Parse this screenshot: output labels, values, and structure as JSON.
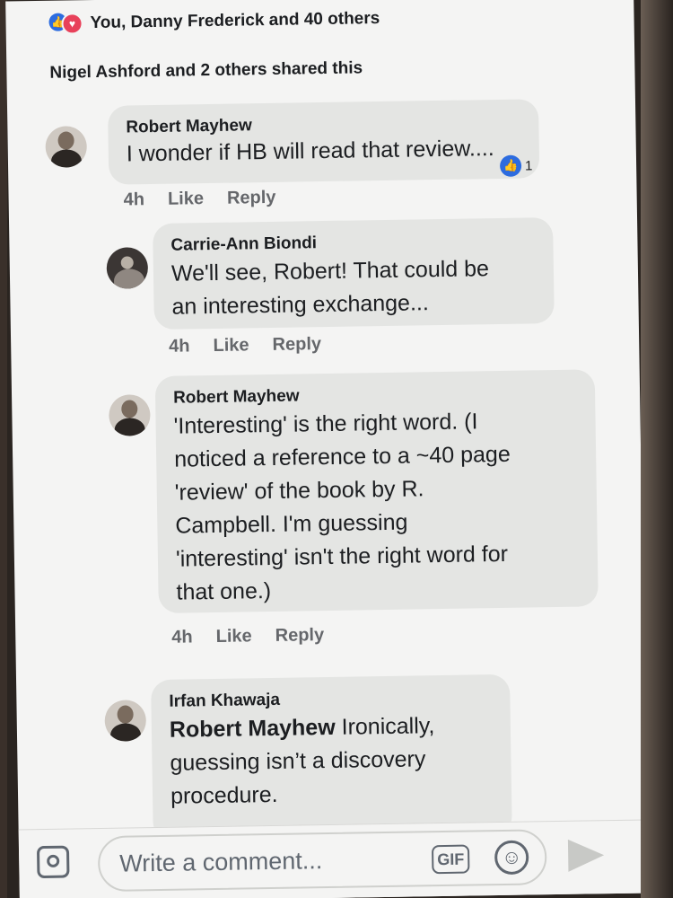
{
  "post": {
    "reactions_text": "You, Danny Frederick and 40 others",
    "shared_text": "Nigel Ashford and 2 others shared this"
  },
  "comments": [
    {
      "author": "Robert Mayhew",
      "text": "I wonder if HB will read that review....",
      "time": "4h",
      "like_label": "Like",
      "reply_label": "Reply",
      "like_count": "1"
    },
    {
      "author": "Carrie-Ann Biondi",
      "text_lines": [
        "We'll see, Robert! That could be",
        "an interesting exchange..."
      ],
      "time": "4h",
      "like_label": "Like",
      "reply_label": "Reply"
    },
    {
      "author": "Robert Mayhew",
      "text_lines": [
        "'Interesting' is the right word. (I",
        "noticed a reference to a ~40 page",
        "'review' of the book by R.",
        "Campbell. I'm guessing",
        "'interesting' isn't the right word for",
        "that one.)"
      ],
      "time": "4h",
      "like_label": "Like",
      "reply_label": "Reply"
    },
    {
      "author": "Irfan Khawaja",
      "mention": "Robert Mayhew",
      "text_lines": [
        "Ironically,",
        "guessing isn’t a discovery",
        "procedure."
      ]
    }
  ],
  "composer": {
    "placeholder": "Write a comment...",
    "gif_label": "GIF"
  },
  "icons": {
    "like": "like-icon",
    "love": "love-icon",
    "camera": "camera-icon",
    "emoji": "emoji-icon",
    "send": "send-icon"
  },
  "colors": {
    "like_blue": "#2d6cdf",
    "love_red": "#e8415a",
    "bubble_gray": "#e4e5e3"
  }
}
